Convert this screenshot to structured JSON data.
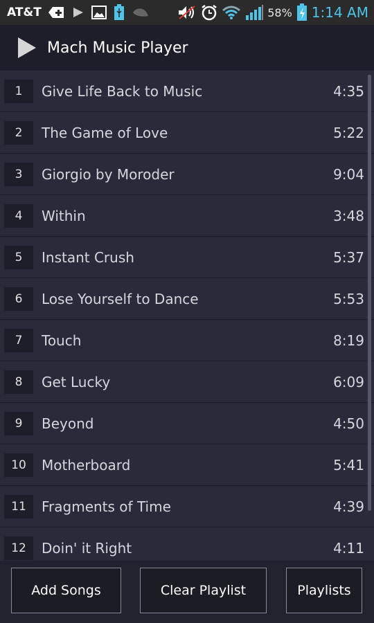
{
  "status_bar": {
    "carrier": "AT&T",
    "battery_percent": "58%",
    "time": "1:14 AM",
    "icons": [
      "plus-badge-icon",
      "play-notification-icon",
      "image-icon",
      "usb-icon",
      "leaf-icon",
      "muted-speaker-icon",
      "alarm-clock-icon",
      "wifi-icon",
      "signal-bars-icon",
      "battery-charging-icon"
    ]
  },
  "header": {
    "title": "Mach Music Player",
    "icon": "play-icon"
  },
  "playlist": [
    {
      "num": "1",
      "title": "Give Life Back to Music",
      "duration": "4:35"
    },
    {
      "num": "2",
      "title": "The Game of Love",
      "duration": "5:22"
    },
    {
      "num": "3",
      "title": "Giorgio by Moroder",
      "duration": "9:04"
    },
    {
      "num": "4",
      "title": "Within",
      "duration": "3:48"
    },
    {
      "num": "5",
      "title": "Instant Crush",
      "duration": "5:37"
    },
    {
      "num": "6",
      "title": "Lose Yourself to Dance",
      "duration": "5:53"
    },
    {
      "num": "7",
      "title": "Touch",
      "duration": "8:19"
    },
    {
      "num": "8",
      "title": "Get Lucky",
      "duration": "6:09"
    },
    {
      "num": "9",
      "title": "Beyond",
      "duration": "4:50"
    },
    {
      "num": "10",
      "title": "Motherboard",
      "duration": "5:41"
    },
    {
      "num": "11",
      "title": "Fragments of Time",
      "duration": "4:39"
    },
    {
      "num": "12",
      "title": "Doin' it Right",
      "duration": "4:11"
    }
  ],
  "footer": {
    "add_songs": "Add Songs",
    "clear_playlist": "Clear Playlist",
    "playlists": "Playlists"
  },
  "colors": {
    "accent": "#4fc3e8",
    "background": "#2a2a3a",
    "header": "#1e1e2a"
  }
}
